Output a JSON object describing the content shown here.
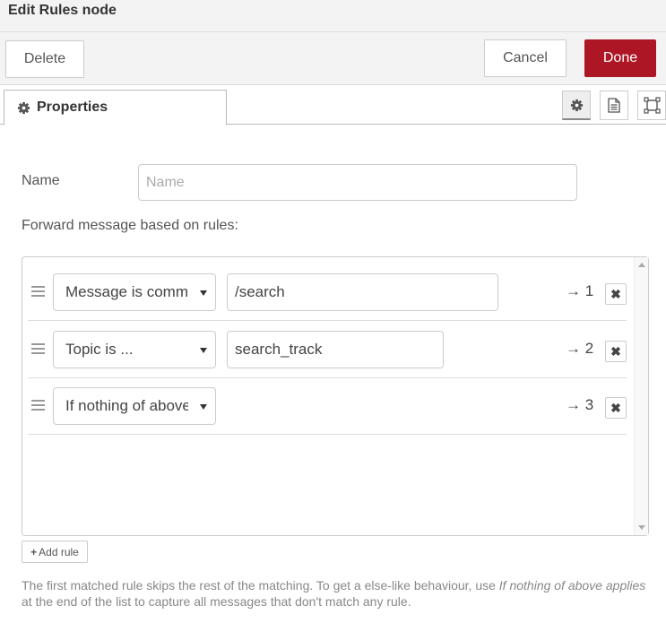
{
  "title": "Edit Rules node",
  "toolbar": {
    "delete_label": "Delete",
    "cancel_label": "Cancel",
    "done_label": "Done",
    "done_color": "#ad1625"
  },
  "tabs": {
    "properties_label": "Properties",
    "icons": [
      "gear-icon",
      "description-icon",
      "appearance-icon"
    ]
  },
  "form": {
    "name_label": "Name",
    "name_placeholder": "Name",
    "name_value": "",
    "forward_label": "Forward message based on rules:"
  },
  "rules": [
    {
      "type": "Message is comm",
      "value": "/search",
      "output": "→ 1"
    },
    {
      "type": "Topic is ...",
      "value": "search_track",
      "output": "→ 2"
    },
    {
      "type": "If nothing of above",
      "value": "",
      "output": "→ 3"
    }
  ],
  "add_rule_label": "Add rule",
  "help": {
    "part1": "The first matched rule skips the rest of the matching. To get a else-like behaviour, use ",
    "italic": "If nothing of above applies",
    "part2": " at the end of the list to capture all messages that don't match any rule."
  }
}
